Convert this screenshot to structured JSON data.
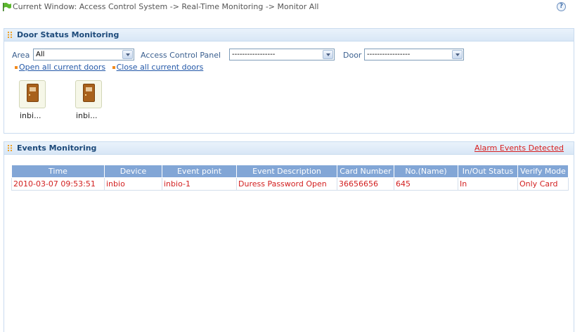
{
  "breadcrumb": {
    "prefix": "Current Window:",
    "path": "Access Control System -> Real-Time Monitoring -> Monitor All"
  },
  "help_icon": "?",
  "door_panel": {
    "title": "Door Status Monitoring",
    "area_label": "Area",
    "area_value": "All",
    "acp_label": "Access Control Panel",
    "acp_value": "-----------------",
    "door_label": "Door",
    "door_value": "-----------------",
    "open_link": "Open all current doors",
    "close_link": "Close all current doors",
    "doors": [
      {
        "name": "inbi..."
      },
      {
        "name": "inbi..."
      }
    ]
  },
  "events_panel": {
    "title": "Events Monitoring",
    "alarm_link": "Alarm Events Detected",
    "columns": [
      "Time",
      "Device",
      "Event point",
      "Event Description",
      "Card Number",
      "No.(Name)",
      "In/Out Status",
      "Verify Mode"
    ],
    "rows": [
      [
        "2010-03-07 09:53:51",
        "inbio",
        "inbio-1",
        "Duress Password Open",
        "36656656",
        "645",
        "In",
        "Only Card"
      ]
    ]
  },
  "colors": {
    "header_text": "#1d4a7a",
    "table_header_bg": "#82a6d6",
    "event_text": "#d21f1f",
    "link": "#2358a8"
  }
}
